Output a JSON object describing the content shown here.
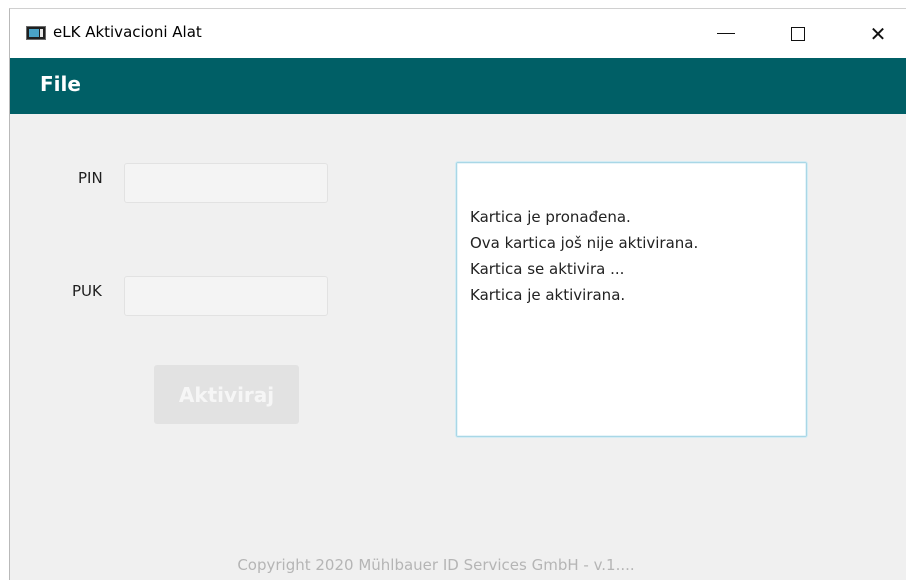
{
  "window": {
    "title": "eLK Aktivacioni Alat",
    "icon": "app-icon",
    "controls": {
      "minimize": "minimize-icon",
      "maximize": "maximize-icon",
      "close_glyph": "✕"
    }
  },
  "menu": {
    "file_label": "File"
  },
  "form": {
    "pin_label": "PIN",
    "pin_value": "",
    "puk_label": "PUK",
    "puk_value": "",
    "activate_label": "Aktiviraj"
  },
  "log": {
    "lines": [
      "Kartica je pronađena.",
      "Ova kartica još nije aktivirana.",
      "Kartica se aktivira ...",
      "Kartica je aktivirana."
    ]
  },
  "footer": {
    "copyright": "Copyright 2020 Mühlbauer ID Services GmbH - v.1...."
  },
  "colors": {
    "menubar": "#005f66",
    "background": "#f0f0f0",
    "button_disabled": "#e2e2e2",
    "log_border": "#a9d7e6"
  }
}
